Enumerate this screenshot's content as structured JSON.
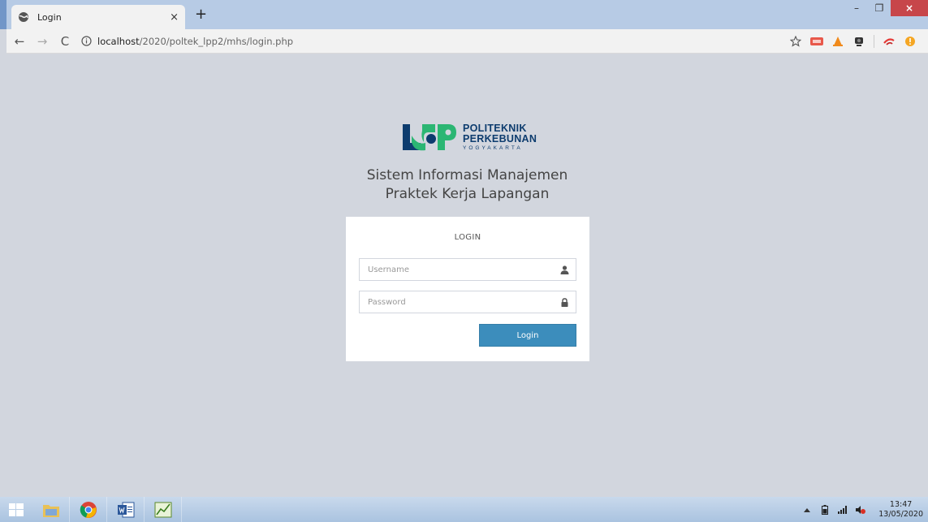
{
  "browser": {
    "tab_title": "Login",
    "tab_close": "×",
    "new_tab": "+",
    "url_host": "localhost",
    "url_path": "/2020/poltek_lpp2/mhs/login.php",
    "nav_back": "←",
    "nav_forward": "→",
    "nav_reload": "C",
    "minimize": "–",
    "restore": "❐",
    "close": "×"
  },
  "logo": {
    "line1": "POLITEKNIK",
    "line2": "PERKEBUNAN",
    "line3": "YOGYAKARTA"
  },
  "app": {
    "title_line1": "Sistem Informasi Manajemen",
    "title_line2": "Praktek Kerja Lapangan"
  },
  "login": {
    "heading": "LOGIN",
    "username_placeholder": "Username",
    "password_placeholder": "Password",
    "button_label": "Login"
  },
  "taskbar": {
    "time": "13:47",
    "date": "13/05/2020"
  },
  "colors": {
    "page_bg": "#d2d6de",
    "primary_button": "#3c8dbc",
    "logo_navy": "#0d3c6e",
    "logo_green": "#2bb673"
  }
}
